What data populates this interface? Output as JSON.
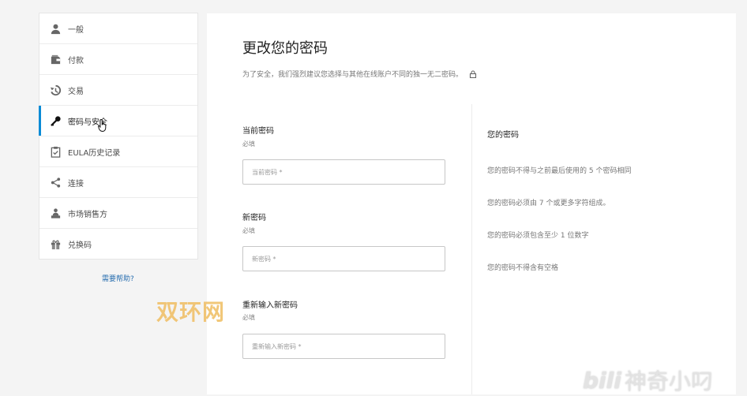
{
  "sidebar": {
    "items": [
      {
        "label": "一般",
        "icon": "user-icon"
      },
      {
        "label": "付款",
        "icon": "wallet-icon"
      },
      {
        "label": "交易",
        "icon": "history-icon"
      },
      {
        "label": "密码与安全",
        "icon": "key-icon",
        "active": true
      },
      {
        "label": "EULA历史记录",
        "icon": "clipboard-check-icon"
      },
      {
        "label": "连接",
        "icon": "share-icon"
      },
      {
        "label": "市场销售方",
        "icon": "seller-icon"
      },
      {
        "label": "兑换码",
        "icon": "gift-icon"
      }
    ],
    "help_link": "需要帮助?"
  },
  "main": {
    "title": "更改您的密码",
    "description": "为了安全，我们强烈建议您选择与其他在线账户不同的独一无二密码。",
    "fields": [
      {
        "label": "当前密码",
        "required": "必填",
        "placeholder": "当前密码 *"
      },
      {
        "label": "新密码",
        "required": "必填",
        "placeholder": "新密码 *"
      },
      {
        "label": "重新输入新密码",
        "required": "必填",
        "placeholder": "重新输入新密码 *"
      }
    ],
    "rules": {
      "title": "您的密码",
      "items": [
        "您的密码不得与之前最后使用的 5 个密码相同",
        "您的密码必须由 7 个或更多字符组成。",
        "您的密码必须包含至少 1 位数字",
        "您的密码不得含有空格"
      ]
    }
  },
  "watermarks": {
    "brand": "双环网",
    "video": "神奇小叼"
  },
  "colors": {
    "accent": "#0a8bd6",
    "link": "#2a6fb0",
    "watermark": "#f0c16a"
  }
}
